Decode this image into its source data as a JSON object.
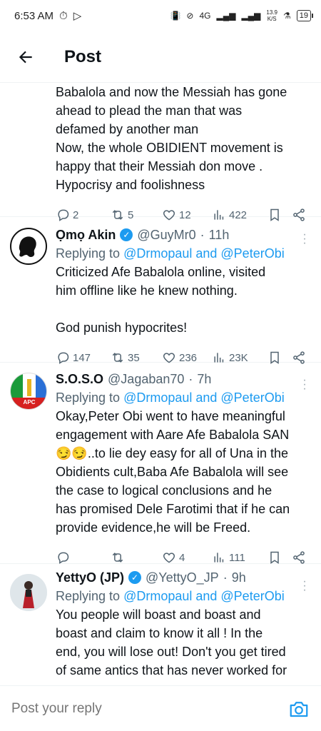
{
  "status": {
    "time": "6:53 AM",
    "network": "4G",
    "speed_value": "13.9",
    "speed_unit": "K/S",
    "battery": "19"
  },
  "header": {
    "title": "Post"
  },
  "tweets": [
    {
      "body": "Babalola and now the Messiah has gone\nahead to plead the man that was\ndefamed by another man\nNow, the whole OBIDIENT movement is\nhappy that their Messiah don move .\nHypocrisy and foolishness",
      "replies": "2",
      "reposts": "5",
      "likes": "12",
      "views": "422"
    },
    {
      "name": "Ọmọ Akin",
      "verified": true,
      "handle": "@GuyMr0",
      "time": "11h",
      "reply_prefix": "Replying to ",
      "mentions": "@Drmopaul and @PeterObi",
      "body": "Criticized Afe Babalola online, visited\nhim offline like he knew nothing.\n\nGod punish hypocrites!",
      "replies": "147",
      "reposts": "35",
      "likes": "236",
      "views": "23K"
    },
    {
      "name": "S.O.S.O",
      "verified": false,
      "handle": "@Jagaban70",
      "time": "7h",
      "reply_prefix": "Replying to ",
      "mentions": "@Drmopaul and @PeterObi",
      "body": "Okay,Peter Obi went to have meaningful\nengagement with Aare Afe Babalola SAN\n😏😏..to lie dey easy for all of Una in the\nObidients cult,Baba Afe Babalola will see\nthe case to logical conclusions and he\nhas promised Dele Farotimi that if he can\nprovide evidence,he will be Freed.",
      "replies": "",
      "reposts": "",
      "likes": "4",
      "views": "111",
      "avatar_text": "APC"
    },
    {
      "name": "YettyO (JP)",
      "verified": true,
      "handle": "@YettyO_JP",
      "time": "9h",
      "reply_prefix": "Replying to ",
      "mentions": "@Drmopaul and @PeterObi",
      "body": "You people will boast and boast and\nboast and claim to know it all !  In the\nend, you will lose out!  Don't you get tired\nof same antics that has never worked for"
    }
  ],
  "reply_bar": {
    "placeholder": "Post your reply"
  },
  "colors": {
    "accent": "#1d9bf0",
    "muted": "#536471",
    "text": "#0f1419"
  }
}
